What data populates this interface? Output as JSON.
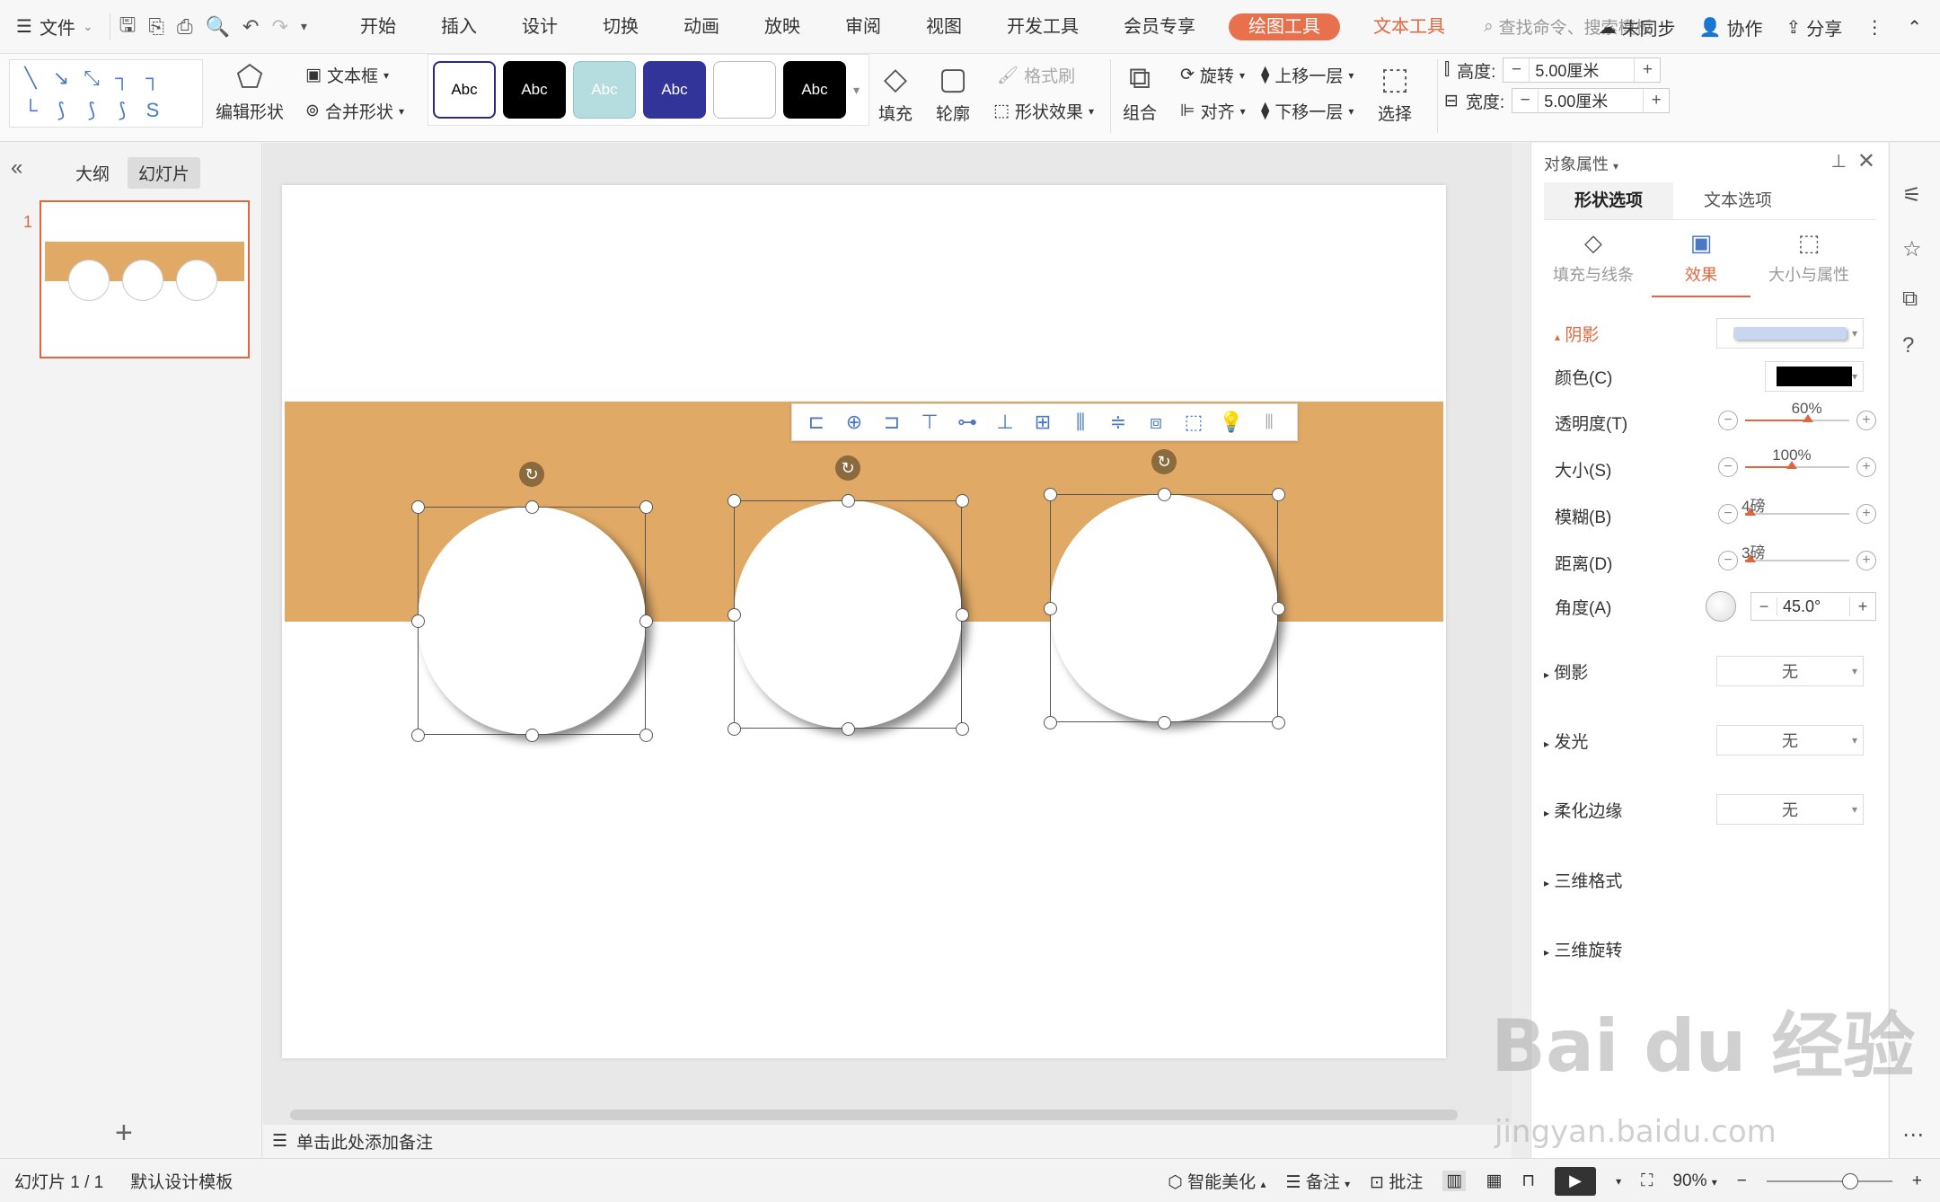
{
  "menubar": {
    "file": "文件",
    "tabs": [
      "开始",
      "插入",
      "设计",
      "切换",
      "动画",
      "放映",
      "审阅",
      "视图",
      "开发工具",
      "会员专享"
    ],
    "drawing_tool": "绘图工具",
    "text_tool": "文本工具",
    "search_placeholder": "查找命令、搜索模板",
    "unsynced": "未同步",
    "collab": "协作",
    "share": "分享"
  },
  "ribbon": {
    "edit_shape": "编辑形状",
    "text_box": "文本框",
    "merge_shape": "合并形状",
    "style_label": "Abc",
    "fill": "填充",
    "outline": "轮廓",
    "format_brush": "格式刷",
    "shape_effect": "形状效果",
    "group": "组合",
    "rotate": "旋转",
    "align": "对齐",
    "bring_forward": "上移一层",
    "send_backward": "下移一层",
    "select": "选择",
    "height_label": "高度:",
    "height_value": "5.00厘米",
    "width_label": "宽度:",
    "width_value": "5.00厘米"
  },
  "leftpanel": {
    "outline_tab": "大纲",
    "slides_tab": "幻灯片",
    "slide_number": "1"
  },
  "notes": {
    "placeholder": "单击此处添加备注"
  },
  "props": {
    "title": "对象属性",
    "tab_shape": "形状选项",
    "tab_text": "文本选项",
    "sub_fill": "填充与线条",
    "sub_effect": "效果",
    "sub_size": "大小与属性",
    "shadow": "阴影",
    "color": "颜色(C)",
    "transparency": "透明度(T)",
    "transparency_value": "60%",
    "size": "大小(S)",
    "size_value": "100%",
    "blur": "模糊(B)",
    "blur_value": "4磅",
    "distance": "距离(D)",
    "distance_value": "3磅",
    "angle": "角度(A)",
    "angle_value": "45.0°",
    "reflection": "倒影",
    "glow": "发光",
    "soft_edge": "柔化边缘",
    "format_3d": "三维格式",
    "rotation_3d": "三维旋转",
    "none": "无"
  },
  "statusbar": {
    "slide_info": "幻灯片 1 / 1",
    "template": "默认设计模板",
    "beautify": "智能美化",
    "notes": "备注",
    "comment": "批注",
    "zoom": "90%"
  },
  "watermark": {
    "main": "Bai du 经验",
    "sub": "jingyan.baidu.com"
  },
  "colors": {
    "accent": "#e0663f",
    "band": "#e0a966",
    "icon_blue": "#4a78c2"
  }
}
